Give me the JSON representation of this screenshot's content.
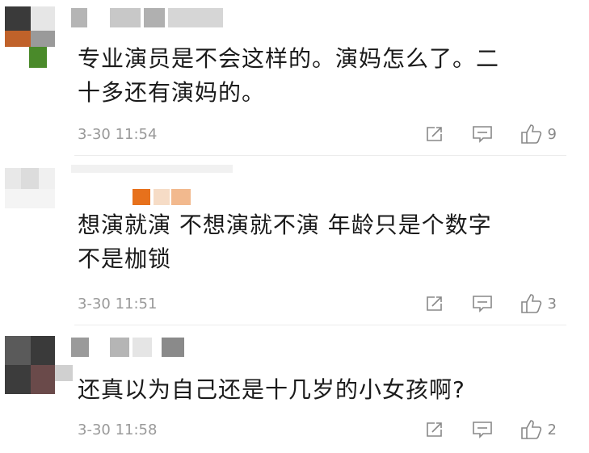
{
  "comments": [
    {
      "text_line1": "专业演员是不会这样的。演妈怎么了。二",
      "text_line2": "十多还有演妈的。",
      "time": "3-30 11:54",
      "likes": "9",
      "icons": [
        "edit-icon",
        "reply-icon",
        "thumbs-up-icon"
      ]
    },
    {
      "text_line1": "想演就演 不想演就不演 年龄只是个数字",
      "text_line2": "不是枷锁",
      "time": "3-30 11:51",
      "likes": "3",
      "icons": [
        "edit-icon",
        "reply-icon",
        "thumbs-up-icon"
      ]
    },
    {
      "text_line1": "还真以为自己还是十几岁的小女孩啊?",
      "time": "3-30 11:58",
      "likes": "2",
      "icons": [
        "edit-icon",
        "reply-icon",
        "thumbs-up-icon"
      ]
    }
  ],
  "colors": {
    "meta_text": "#999999",
    "icon": "#888888",
    "divider": "#ececec"
  }
}
